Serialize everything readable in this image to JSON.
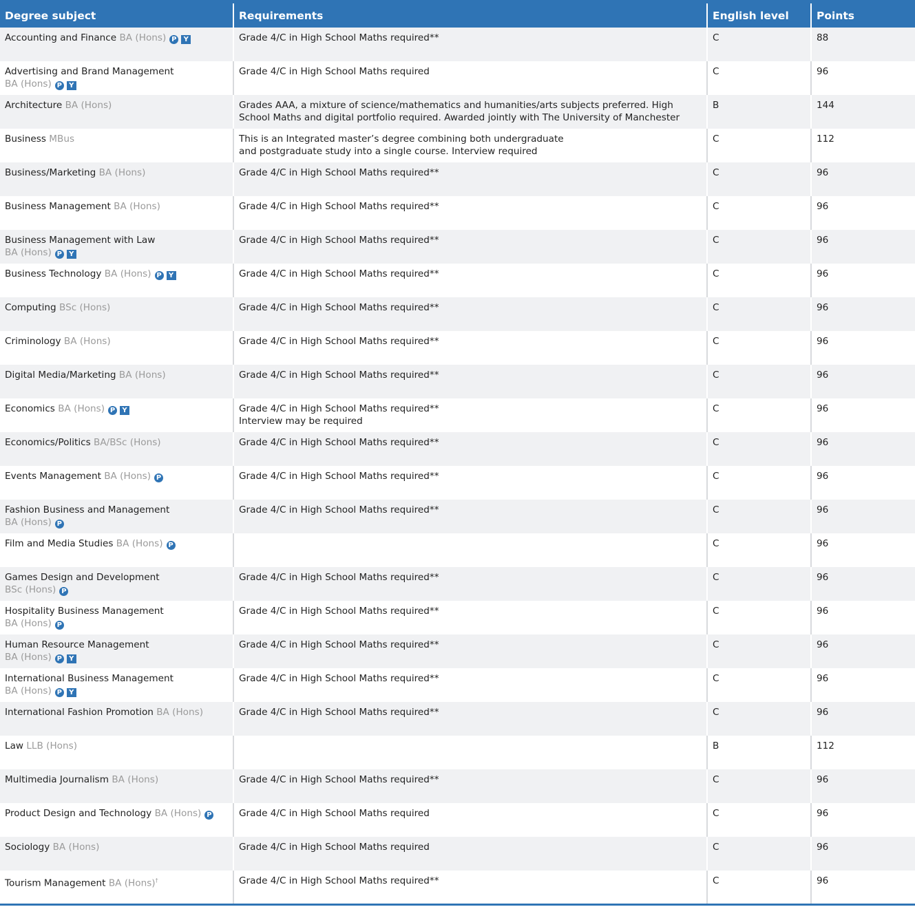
{
  "headers": {
    "subject": "Degree subject",
    "requirements": "Requirements",
    "english": "English level",
    "points": "Points"
  },
  "colors": {
    "header_bg": "#2f74b5",
    "row_shade": "#f0f1f3",
    "qualification_text": "#9a9a9a"
  },
  "badge_legend": {
    "p": "P",
    "y": "Y"
  },
  "rows": [
    {
      "subject": "Accounting and Finance",
      "qualification": "BA (Hons)",
      "break": false,
      "p": true,
      "y": true,
      "requirements": [
        "Grade 4/C in High School Maths required**"
      ],
      "english": "C",
      "points": "88"
    },
    {
      "subject": "Advertising and Brand Management",
      "qualification": "BA (Hons)",
      "break": true,
      "p": true,
      "y": true,
      "requirements": [
        "Grade 4/C in High School Maths required"
      ],
      "english": "C",
      "points": "96"
    },
    {
      "subject": "Architecture",
      "qualification": "BA (Hons)",
      "break": false,
      "p": false,
      "y": false,
      "requirements": [
        "Grades AAA, a mixture of science/mathematics and humanities/arts subjects preferred. High School Maths and digital portfolio required. Awarded jointly with The University of Manchester"
      ],
      "english": "B",
      "points": "144"
    },
    {
      "subject": "Business",
      "qualification": "MBus",
      "break": false,
      "p": false,
      "y": false,
      "requirements": [
        "This is an Integrated master’s degree combining both undergraduate",
        "and postgraduate study into a single course. Interview required"
      ],
      "english": "C",
      "points": "112"
    },
    {
      "subject": "Business/Marketing",
      "qualification": "BA (Hons)",
      "break": false,
      "p": false,
      "y": false,
      "requirements": [
        "Grade 4/C in High School Maths required**"
      ],
      "english": "C",
      "points": "96"
    },
    {
      "subject": "Business Management",
      "qualification": "BA (Hons)",
      "break": false,
      "p": false,
      "y": false,
      "requirements": [
        "Grade 4/C in High School Maths required**"
      ],
      "english": "C",
      "points": "96"
    },
    {
      "subject": "Business Management with Law",
      "qualification": "BA (Hons)",
      "break": true,
      "p": true,
      "y": true,
      "requirements": [
        "Grade 4/C in High School Maths required**"
      ],
      "english": "C",
      "points": "96"
    },
    {
      "subject": "Business Technology",
      "qualification": "BA (Hons)",
      "break": false,
      "p": true,
      "y": true,
      "requirements": [
        "Grade 4/C in High School Maths required**"
      ],
      "english": "C",
      "points": "96"
    },
    {
      "subject": "Computing",
      "qualification": "BSc (Hons)",
      "break": false,
      "p": false,
      "y": false,
      "requirements": [
        "Grade 4/C in High School Maths required**"
      ],
      "english": "C",
      "points": "96"
    },
    {
      "subject": "Criminology",
      "qualification": "BA (Hons)",
      "break": false,
      "p": false,
      "y": false,
      "requirements": [
        "Grade 4/C in High School Maths required**"
      ],
      "english": "C",
      "points": "96"
    },
    {
      "subject": "Digital Media/Marketing",
      "qualification": "BA (Hons)",
      "break": false,
      "p": false,
      "y": false,
      "requirements": [
        "Grade 4/C in High School Maths required**"
      ],
      "english": "C",
      "points": "96"
    },
    {
      "subject": "Economics",
      "qualification": "BA (Hons)",
      "break": false,
      "p": true,
      "y": true,
      "requirements": [
        "Grade 4/C in High School Maths required**",
        "Interview may be required"
      ],
      "english": "C",
      "points": "96"
    },
    {
      "subject": "Economics/Politics",
      "qualification": "BA/BSc (Hons)",
      "break": false,
      "p": false,
      "y": false,
      "requirements": [
        "Grade 4/C in High School Maths required**"
      ],
      "english": "C",
      "points": "96"
    },
    {
      "subject": "Events Management",
      "qualification": "BA (Hons)",
      "break": false,
      "p": true,
      "y": false,
      "requirements": [
        "Grade 4/C in High School Maths required**"
      ],
      "english": "C",
      "points": "96"
    },
    {
      "subject": "Fashion Business and Management",
      "qualification": "BA (Hons)",
      "break": true,
      "p": true,
      "y": false,
      "requirements": [
        "Grade 4/C in High School Maths required**"
      ],
      "english": "C",
      "points": "96"
    },
    {
      "subject": "Film and Media Studies",
      "qualification": "BA (Hons)",
      "break": false,
      "p": true,
      "y": false,
      "requirements": [],
      "english": "C",
      "points": "96"
    },
    {
      "subject": "Games Design and Development",
      "qualification": "BSc (Hons)",
      "break": true,
      "p": true,
      "y": false,
      "requirements": [
        "Grade 4/C in High School Maths required**"
      ],
      "english": "C",
      "points": "96"
    },
    {
      "subject": "Hospitality Business Management",
      "qualification": "BA (Hons)",
      "break": true,
      "p": true,
      "y": false,
      "requirements": [
        "Grade 4/C in High School Maths required**"
      ],
      "english": "C",
      "points": "96"
    },
    {
      "subject": "Human Resource Management",
      "qualification": "BA (Hons)",
      "break": true,
      "p": true,
      "y": true,
      "requirements": [
        "Grade 4/C in High School Maths required**"
      ],
      "english": "C",
      "points": "96"
    },
    {
      "subject": "International Business Management",
      "qualification": "BA (Hons)",
      "break": true,
      "p": true,
      "y": true,
      "requirements": [
        "Grade 4/C in High School Maths required**"
      ],
      "english": "C",
      "points": "96"
    },
    {
      "subject": "International Fashion Promotion",
      "qualification": "BA (Hons)",
      "break": false,
      "p": false,
      "y": false,
      "requirements": [
        "Grade 4/C in High School Maths required**"
      ],
      "english": "C",
      "points": "96"
    },
    {
      "subject": "Law",
      "qualification": "LLB (Hons)",
      "break": false,
      "p": false,
      "y": false,
      "requirements": [],
      "english": "B",
      "points": "112"
    },
    {
      "subject": "Multimedia Journalism",
      "qualification": "BA (Hons)",
      "break": false,
      "p": false,
      "y": false,
      "requirements": [
        "Grade 4/C in High School Maths required**"
      ],
      "english": "C",
      "points": "96"
    },
    {
      "subject": "Product Design and Technology",
      "qualification": "BA (Hons)",
      "break": false,
      "p": true,
      "y": false,
      "requirements": [
        "Grade 4/C in High School Maths required"
      ],
      "english": "C",
      "points": "96"
    },
    {
      "subject": "Sociology",
      "qualification": "BA (Hons)",
      "break": false,
      "p": false,
      "y": false,
      "requirements": [
        "Grade 4/C in High School Maths required"
      ],
      "english": "C",
      "points": "96"
    },
    {
      "subject": "Tourism Management",
      "qualification": "BA (Hons)",
      "footnote": "†",
      "break": false,
      "p": false,
      "y": false,
      "requirements": [
        "Grade 4/C in High School Maths required**"
      ],
      "english": "C",
      "points": "96"
    }
  ]
}
